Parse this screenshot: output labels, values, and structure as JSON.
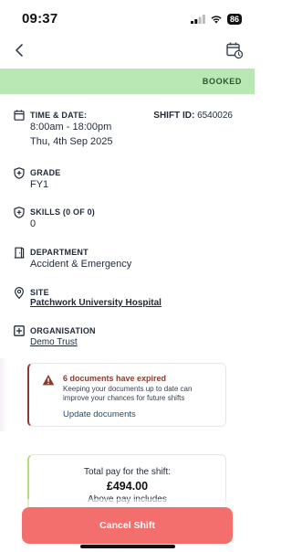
{
  "status_bar": {
    "time": "09:37",
    "battery": "86"
  },
  "nav": {
    "back_icon": "chevron-left-icon",
    "calendar_icon": "calendar-clock-icon"
  },
  "banner": {
    "status": "BOOKED",
    "color": "#b9e8b4",
    "text_color": "#27582c"
  },
  "shift": {
    "time_date_title": "TIME & DATE:",
    "time": "8:00am - 18:00pm",
    "date": "Thu, 4th Sep 2025",
    "shift_id_label": "SHIFT ID:",
    "shift_id": "6540026",
    "grade_title": "GRADE",
    "grade": "FY1",
    "skills_title": "SKILLS (0 OF 0)",
    "skills": "0",
    "department_title": "DEPARTMENT",
    "department": "Accident & Emergency",
    "site_title": "SITE",
    "site": "Patchwork University Hospital",
    "organisation_title": "ORGANISATION",
    "organisation": "Demo Trust"
  },
  "alert": {
    "title": "6 documents have expired",
    "body": "Keeping your documents up to date can improve your chances for future shifts",
    "link": "Update documents",
    "accent": "#8a3b2d"
  },
  "pay": {
    "label": "Total pay for the shift:",
    "amount": "£494.00",
    "extra": "Above pay includes"
  },
  "actions": {
    "cancel_label": "Cancel Shift",
    "cancel_color": "#f36f6d"
  }
}
